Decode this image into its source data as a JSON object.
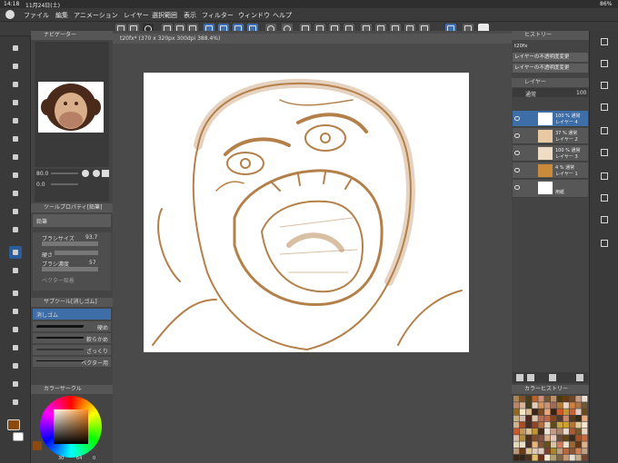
{
  "status": {
    "time": "14:18",
    "date": "11月24日(土)",
    "battery": "86%"
  },
  "menu": {
    "items": [
      "ファイル",
      "編集",
      "アニメーション",
      "レイヤー",
      "選択範囲",
      "表示",
      "フィルター",
      "ウィンドウ",
      "ヘルプ"
    ]
  },
  "navigator": {
    "title": "ナビゲーター",
    "zoom": "80.0",
    "angle": "0.0"
  },
  "tool_property": {
    "title": "ツールプロパティ[鉛筆]",
    "tool": "鉛筆",
    "brush_size_label": "ブラシサイズ",
    "brush_size": "93.7",
    "hardness_label": "硬さ",
    "density_label": "ブラシ濃度",
    "density": "57",
    "vector_label": "ベクター吸着"
  },
  "subtool": {
    "title": "サブツール[消しゴム]",
    "group": "消しゴム",
    "items": [
      {
        "label": "硬め"
      },
      {
        "label": "軟らかめ"
      },
      {
        "label": "ざっくり"
      },
      {
        "label": "ベクター用"
      }
    ]
  },
  "color_circle": {
    "title": "カラーサークル",
    "h": "30",
    "s": "64",
    "v": "0"
  },
  "document": {
    "tab": "t20fx* (370 x 320px 300dpi 388.4%)"
  },
  "history": {
    "title": "ヒストリー",
    "items": [
      "t20fx",
      "レイヤーの不透明度変更",
      "レイヤーの不透明度変更"
    ]
  },
  "layers": {
    "title": "レイヤー",
    "blend": "通常",
    "opacity": "100",
    "rows": [
      {
        "line1": "100 % 通常",
        "line2": "レイヤー 4",
        "selected": true
      },
      {
        "line1": "37 % 通常",
        "line2": "レイヤー 2",
        "selected": false
      },
      {
        "line1": "100 % 通常",
        "line2": "レイヤー 3",
        "selected": false
      },
      {
        "line1": "4 % 通常",
        "line2": "レイヤー 1",
        "selected": false
      },
      {
        "line1": "",
        "line2": "用紙",
        "selected": false
      }
    ]
  },
  "color_history": {
    "title": "カラーヒストリー"
  },
  "colors": {
    "accent": "#2a5d99",
    "sketch": "#a86a2a",
    "panel": "#444444"
  }
}
